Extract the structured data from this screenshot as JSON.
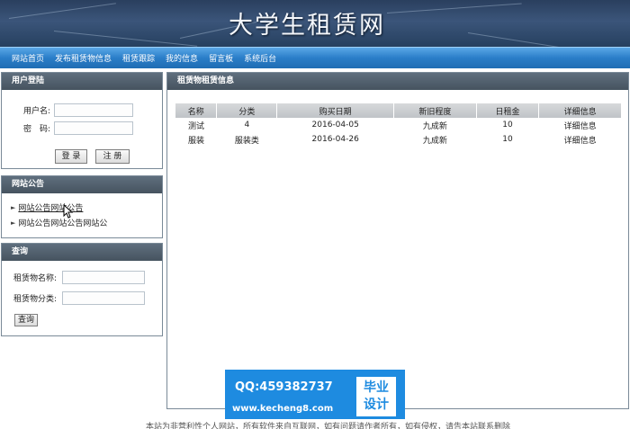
{
  "header": {
    "site_title": "大学生租赁网"
  },
  "nav": {
    "items": [
      "网站首页",
      "发布租赁物信息",
      "租赁跟踪",
      "我的信息",
      "留言板",
      "系统后台"
    ]
  },
  "login": {
    "title": "用户登陆",
    "username_label": "用户名:",
    "password_label": "密　码:",
    "login_button": "登 录",
    "register_button": "注 册"
  },
  "notice": {
    "title": "网站公告",
    "items": [
      "网站公告网站公告",
      "网站公告网站公告网站公"
    ]
  },
  "query": {
    "title": "查询",
    "name_label": "租赁物名称:",
    "category_label": "租赁物分类:",
    "submit": "查询"
  },
  "main": {
    "title": "租赁物租赁信息",
    "columns": [
      "名称",
      "分类",
      "购买日期",
      "新旧程度",
      "日租金",
      "详细信息"
    ],
    "rows": [
      [
        "测试",
        "4",
        "2016-04-05",
        "九成新",
        "10",
        "详细信息"
      ],
      [
        "服装",
        "服装类",
        "2016-04-26",
        "九成新",
        "10",
        "详细信息"
      ]
    ]
  },
  "watermark": {
    "qq": "QQ:459382737",
    "website": "www.kecheng8.com",
    "tag_line1": "毕业",
    "tag_line2": "设计"
  },
  "footer": {
    "text": "本站为非营利性个人网站，所有软件来自互联网，如有问题请作者所有，如有侵权，请告本站联系删除"
  },
  "colors": {
    "nav_blue": "#2a7dc8",
    "panel_head": "#46535f",
    "watermark_blue": "#1e8be0"
  }
}
